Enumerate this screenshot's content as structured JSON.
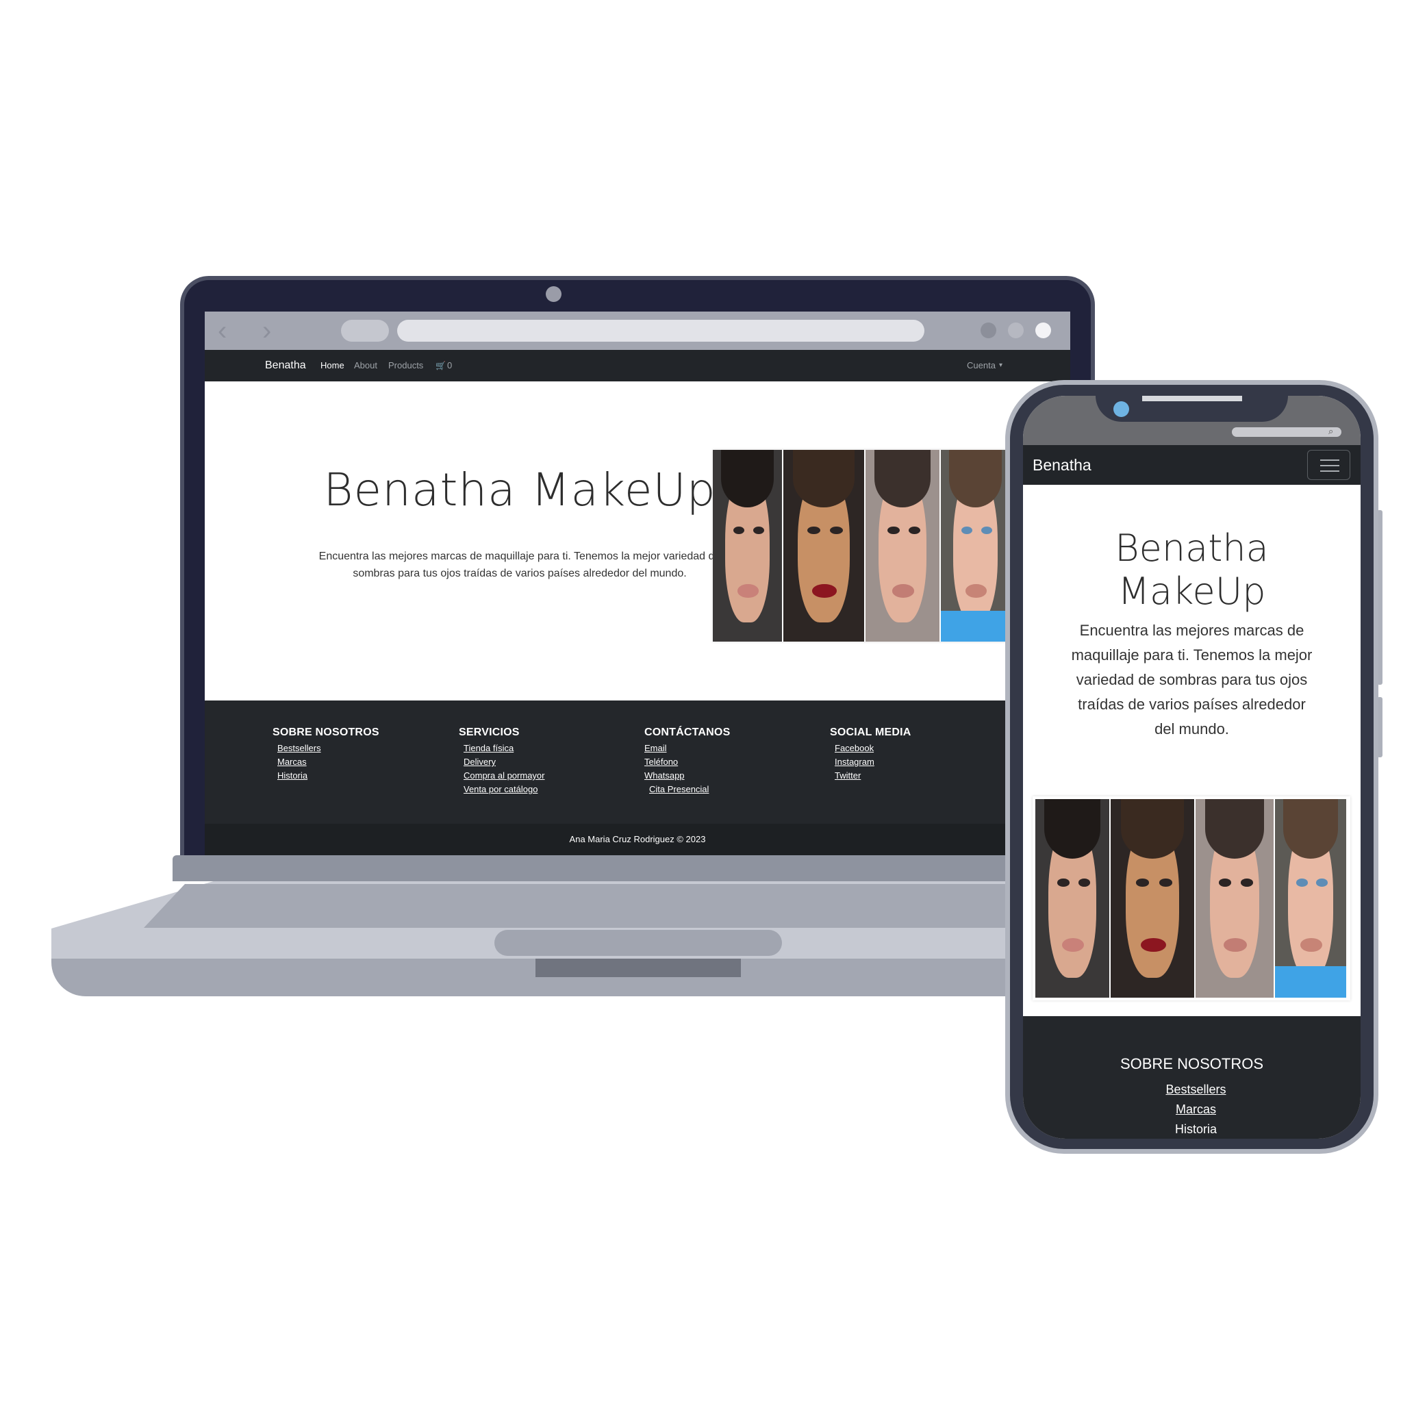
{
  "desktop": {
    "nav": {
      "brand": "Benatha",
      "links": [
        "Home",
        "About",
        "Products"
      ],
      "cart_icon": "cart-icon",
      "cart_count": "0",
      "account": "Cuenta",
      "account_caret": "▾"
    },
    "hero": {
      "title": "Benatha MakeUp",
      "subtitle_line1": "Encuentra las mejores marcas de maquillaje para ti. Tenemos la mejor variedad de",
      "subtitle_line2": "sombras para tus ojos traídas de varios países alrededor del mundo."
    },
    "footer": {
      "columns": [
        {
          "title": "SOBRE NOSOTROS",
          "links": [
            "Bestsellers",
            "Marcas",
            "Historia"
          ]
        },
        {
          "title": "SERVICIOS",
          "links": [
            "Tienda física",
            "Delivery",
            "Compra al pormayor",
            "Venta por catálogo"
          ]
        },
        {
          "title": "CONTÁCTANOS",
          "links": [
            "Email",
            "Teléfono",
            "Whatsapp",
            "Cita Presencial"
          ]
        },
        {
          "title": "SOCIAL MEDIA",
          "links": [
            "Facebook",
            "Instagram",
            "Twitter"
          ]
        }
      ],
      "copyright": "Ana Maria Cruz Rodriguez © 2023"
    }
  },
  "mobile": {
    "nav": {
      "brand": "Benatha",
      "menu_icon": "hamburger-menu-icon"
    },
    "hero": {
      "title_line1": "Benatha",
      "title_line2": "MakeUp",
      "subtitle_lines": [
        "Encuentra las mejores marcas de",
        "maquillaje para ti. Tenemos la mejor",
        "variedad de sombras para tus ojos",
        "traídas de varios países alrededor",
        "del mundo."
      ]
    },
    "footer": {
      "title": "SOBRE NOSOTROS",
      "links": [
        "Bestsellers",
        "Marcas",
        "Historia"
      ]
    }
  },
  "colors": {
    "navbar": "#222529",
    "footer": "#24272b",
    "device_frame": "#20223a"
  }
}
